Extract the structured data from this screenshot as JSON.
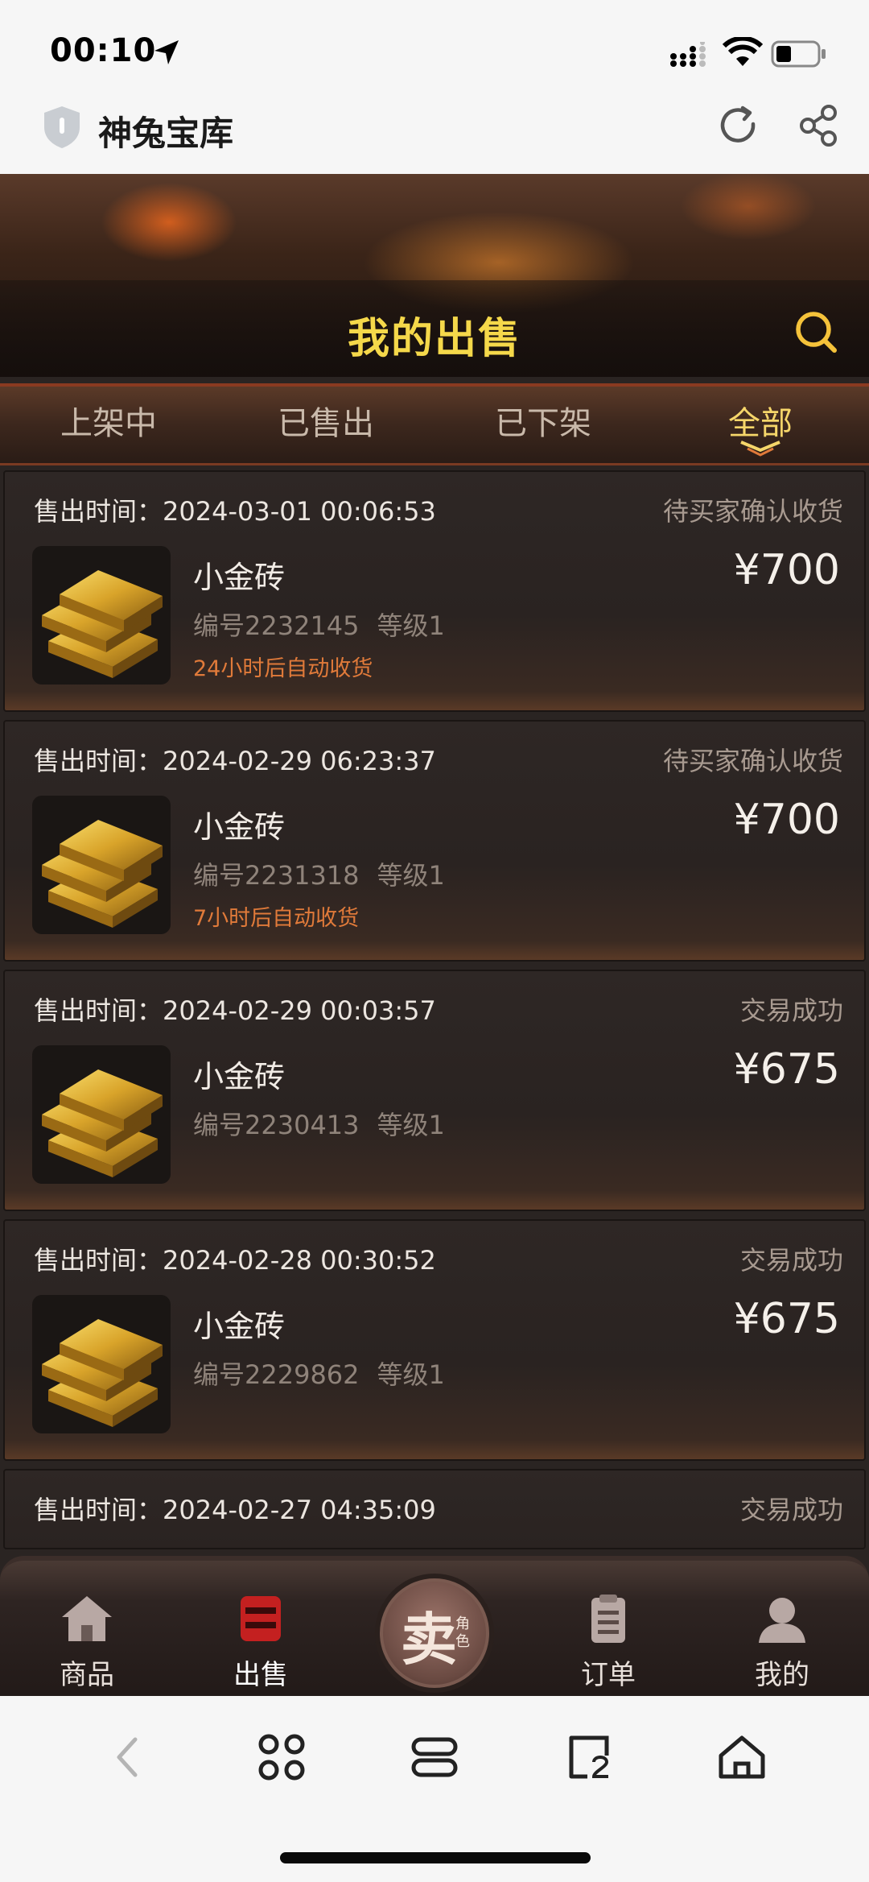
{
  "status": {
    "time": "00:10"
  },
  "browser": {
    "title": "神兔宝库"
  },
  "hero": {
    "title": "我的出售"
  },
  "tabs": [
    {
      "label": "上架中",
      "active": false
    },
    {
      "label": "已售出",
      "active": false
    },
    {
      "label": "已下架",
      "active": false
    },
    {
      "label": "全部",
      "active": true
    }
  ],
  "orders": [
    {
      "time": "售出时间：2024-03-01 00:06:53",
      "status": "待买家确认收货",
      "name": "小金砖",
      "serial": "编号2232145",
      "level": "等级1",
      "note": "24小时后自动收货",
      "price": "¥700"
    },
    {
      "time": "售出时间：2024-02-29 06:23:37",
      "status": "待买家确认收货",
      "name": "小金砖",
      "serial": "编号2231318",
      "level": "等级1",
      "note": "7小时后自动收货",
      "price": "¥700"
    },
    {
      "time": "售出时间：2024-02-29 00:03:57",
      "status": "交易成功",
      "name": "小金砖",
      "serial": "编号2230413",
      "level": "等级1",
      "note": "",
      "price": "¥675"
    },
    {
      "time": "售出时间：2024-02-28 00:30:52",
      "status": "交易成功",
      "name": "小金砖",
      "serial": "编号2229862",
      "level": "等级1",
      "note": "",
      "price": "¥675"
    },
    {
      "time": "售出时间：2024-02-27 04:35:09",
      "status": "交易成功"
    }
  ],
  "nav": {
    "goods": "商品",
    "sell": "出售",
    "sell_btn_main": "卖",
    "sell_btn_sub": "角色",
    "orders": "订单",
    "mine": "我的"
  },
  "colors": {
    "accent": "#f6d66a",
    "note": "#e07a3a",
    "price": "#f5f0ea"
  }
}
